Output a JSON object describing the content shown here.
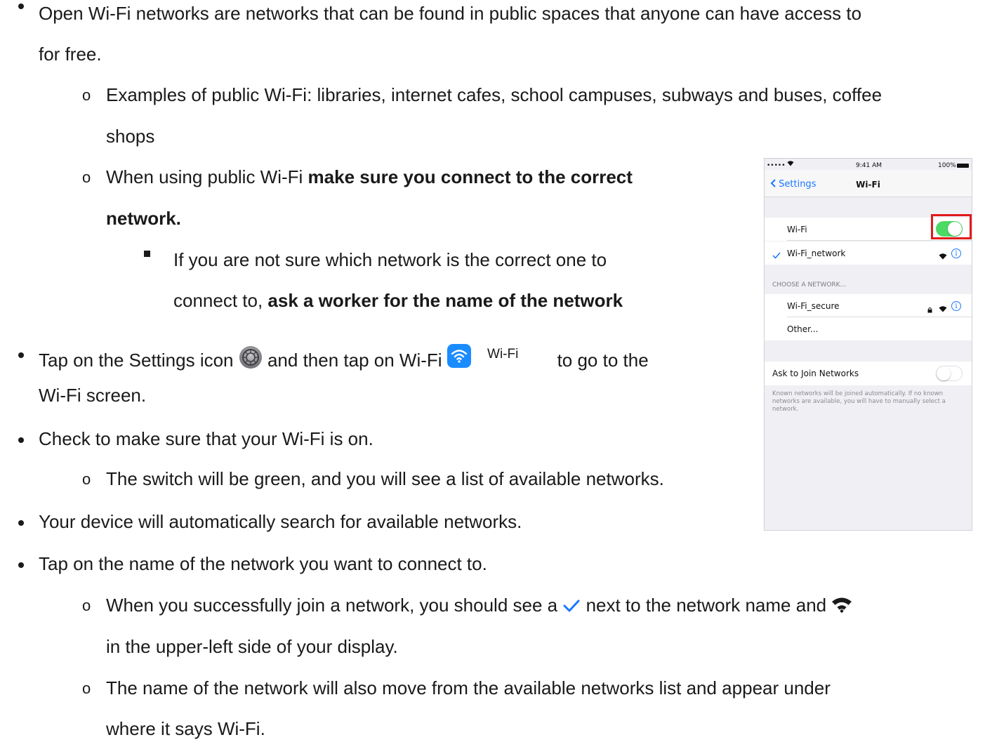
{
  "doc": {
    "b1": "Open Wi-Fi networks are networks that can be found in public spaces that anyone can have access to",
    "b1_cont": "for free.",
    "s1": "Examples of public Wi-Fi:  libraries, internet cafes, school campuses, subways and buses, coffee",
    "s1_cont": "shops",
    "s2_pre": "When using public Wi-Fi ",
    "s2_bold": "make sure you connect to the correct",
    "s2_bold_cont": "network.",
    "ss1": "If you are not sure which network is the correct one to",
    "ss1_cont_pre": "connect to, ",
    "ss1_cont_bold": "ask a worker for the name of the network",
    "b2_pre": "Tap on the Settings icon ",
    "b2_mid": " and then tap on Wi-Fi ",
    "b2_wifi_label": "Wi-Fi",
    "b2_post": "to go to the",
    "b2_cont": "Wi-Fi screen.",
    "b3": "Check to make sure that your Wi-Fi is on.",
    "s3": "The switch will be green, and you will see a list of available networks.",
    "b4": "Your device will automatically search for available networks.",
    "b5": "Tap on the name of the network you want to connect to.",
    "s4_pre": "When you successfully join a network, you should see a ",
    "s4_mid": " next to the network name and ",
    "s4_cont": "in the upper-left side of your display.",
    "s5": "The name of the network will also move from the available networks list and appear under",
    "s5_cont": "where it says Wi-Fi.",
    "bullet_circle": "o"
  },
  "phone": {
    "signal": "••••• ",
    "time": "9:41 AM",
    "battery": "100%",
    "back": "Settings",
    "title": "Wi-Fi",
    "wifi_row": "Wi-Fi",
    "connected_network": "Wi-Fi_network",
    "choose_header": "CHOOSE A NETWORK...",
    "secure_network": "Wi-Fi_secure",
    "other": "Other...",
    "ask_join": "Ask to Join Networks",
    "footer": "Known networks will be joined automatically. If no known networks are available, you will have to manually select a network.",
    "info_glyph": "i",
    "wifi_toggle_on": true,
    "ask_toggle_on": false
  },
  "colors": {
    "toggle_on": "#4cd964",
    "highlight": "#e21a1a",
    "ios_blue": "#1a78ff"
  }
}
